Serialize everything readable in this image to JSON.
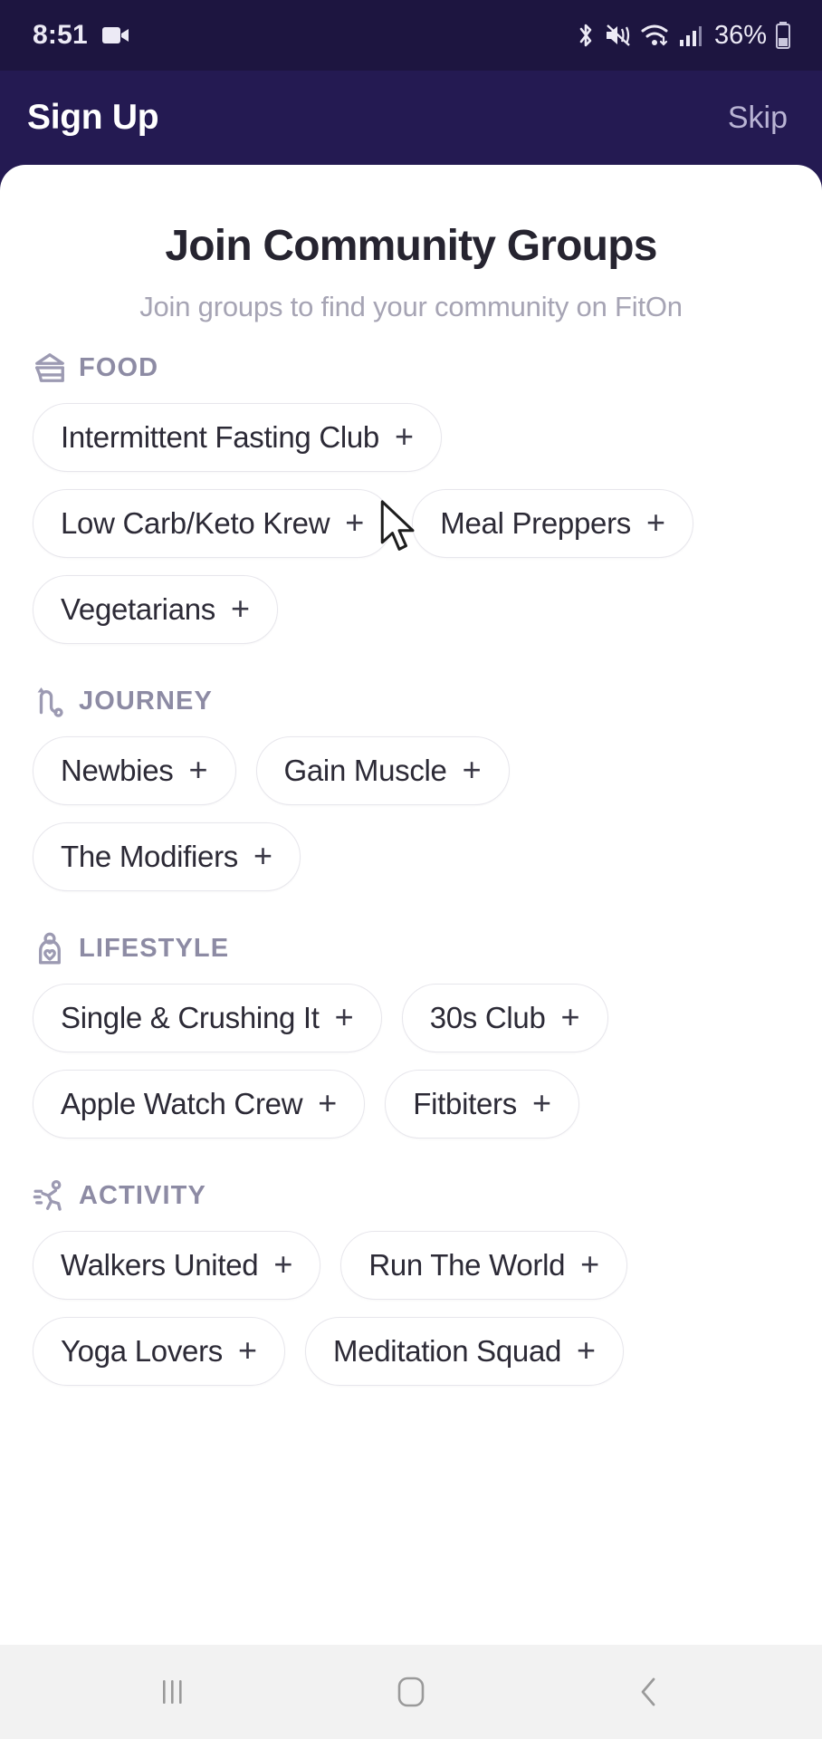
{
  "status_bar": {
    "time": "8:51",
    "battery_percent": "36%",
    "icons": [
      "video-camera-icon",
      "bluetooth-icon",
      "mute-vibrate-icon",
      "wifi-icon",
      "cellular-signal-icon",
      "battery-icon"
    ]
  },
  "header": {
    "title": "Sign Up",
    "skip_label": "Skip"
  },
  "page": {
    "title": "Join Community Groups",
    "subtitle": "Join groups to find your community on FitOn"
  },
  "sections": [
    {
      "label": "FOOD",
      "icon": "sandwich-icon",
      "chips": [
        {
          "label": "Intermittent Fasting Club",
          "action": "+"
        },
        {
          "label": "Low Carb/Keto Krew",
          "action": "+"
        },
        {
          "label": "Meal Preppers",
          "action": "+"
        },
        {
          "label": "Vegetarians",
          "action": "+"
        }
      ]
    },
    {
      "label": "JOURNEY",
      "icon": "route-path-icon",
      "chips": [
        {
          "label": "Newbies",
          "action": "+"
        },
        {
          "label": "Gain Muscle",
          "action": "+"
        },
        {
          "label": "The Modifiers",
          "action": "+"
        }
      ]
    },
    {
      "label": "LIFESTYLE",
      "icon": "person-heart-icon",
      "chips": [
        {
          "label": "Single & Crushing It",
          "action": "+"
        },
        {
          "label": "30s Club",
          "action": "+"
        },
        {
          "label": "Apple Watch Crew",
          "action": "+"
        },
        {
          "label": "Fitbiters",
          "action": "+"
        }
      ]
    },
    {
      "label": "ACTIVITY",
      "icon": "running-person-icon",
      "chips": [
        {
          "label": "Walkers United",
          "action": "+"
        },
        {
          "label": "Run The World",
          "action": "+"
        },
        {
          "label": "Yoga Lovers",
          "action": "+"
        },
        {
          "label": "Meditation Squad",
          "action": "+"
        }
      ]
    }
  ],
  "nav_bar": {
    "recents_label": "recents-icon",
    "home_label": "home-icon",
    "back_label": "back-icon"
  },
  "colors": {
    "header_bg": "#241a52",
    "status_bg": "#1d1540",
    "sheet_bg": "#ffffff",
    "title_text": "#262430",
    "subtitle_text": "#a6a4b4",
    "section_label": "#8d8ba4",
    "chip_border": "#e7e6ec",
    "chip_text": "#2c2a36",
    "skip_text": "#b9b4d4",
    "nav_bg": "#f2f2f2"
  }
}
